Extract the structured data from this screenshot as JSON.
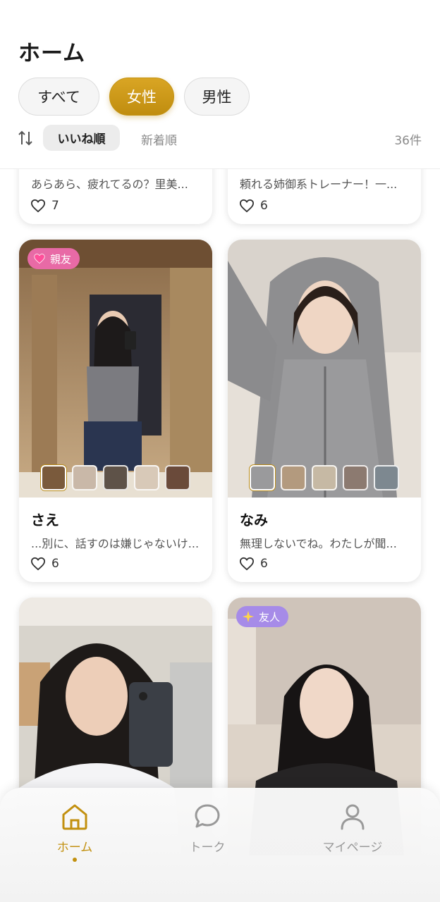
{
  "header": {
    "title": "ホーム"
  },
  "filters": [
    {
      "label": "すべて",
      "active": false
    },
    {
      "label": "女性",
      "active": true
    },
    {
      "label": "男性",
      "active": false
    }
  ],
  "sort": {
    "active": "いいね順",
    "other": "新着順",
    "count": "36件"
  },
  "cards": [
    {
      "name": "",
      "desc": "あらあら、疲れてるの？里美...",
      "likes": "7"
    },
    {
      "name": "",
      "desc": "頼れる姉御系トレーナー！一...",
      "likes": "6"
    },
    {
      "name": "さえ",
      "desc": "...別に、話すのは嫌じゃないけ...",
      "likes": "6",
      "badge": "親友",
      "badge_icon": "broken-heart-icon"
    },
    {
      "name": "なみ",
      "desc": "無理しないでね。わたしが聞...",
      "likes": "6"
    },
    {
      "name": "",
      "desc": "",
      "likes": ""
    },
    {
      "name": "",
      "desc": "",
      "likes": "",
      "badge": "友人",
      "badge_icon": "sparkle-star-icon"
    }
  ],
  "nav": [
    {
      "label": "ホーム",
      "icon": "home-icon",
      "active": true
    },
    {
      "label": "トーク",
      "icon": "chat-bubble-icon",
      "active": false
    },
    {
      "label": "マイページ",
      "icon": "user-icon",
      "active": false
    }
  ],
  "colors": {
    "accent": "#c2900f",
    "pink_badge": "#e86aa6",
    "purple_badge": "#a68be8"
  }
}
